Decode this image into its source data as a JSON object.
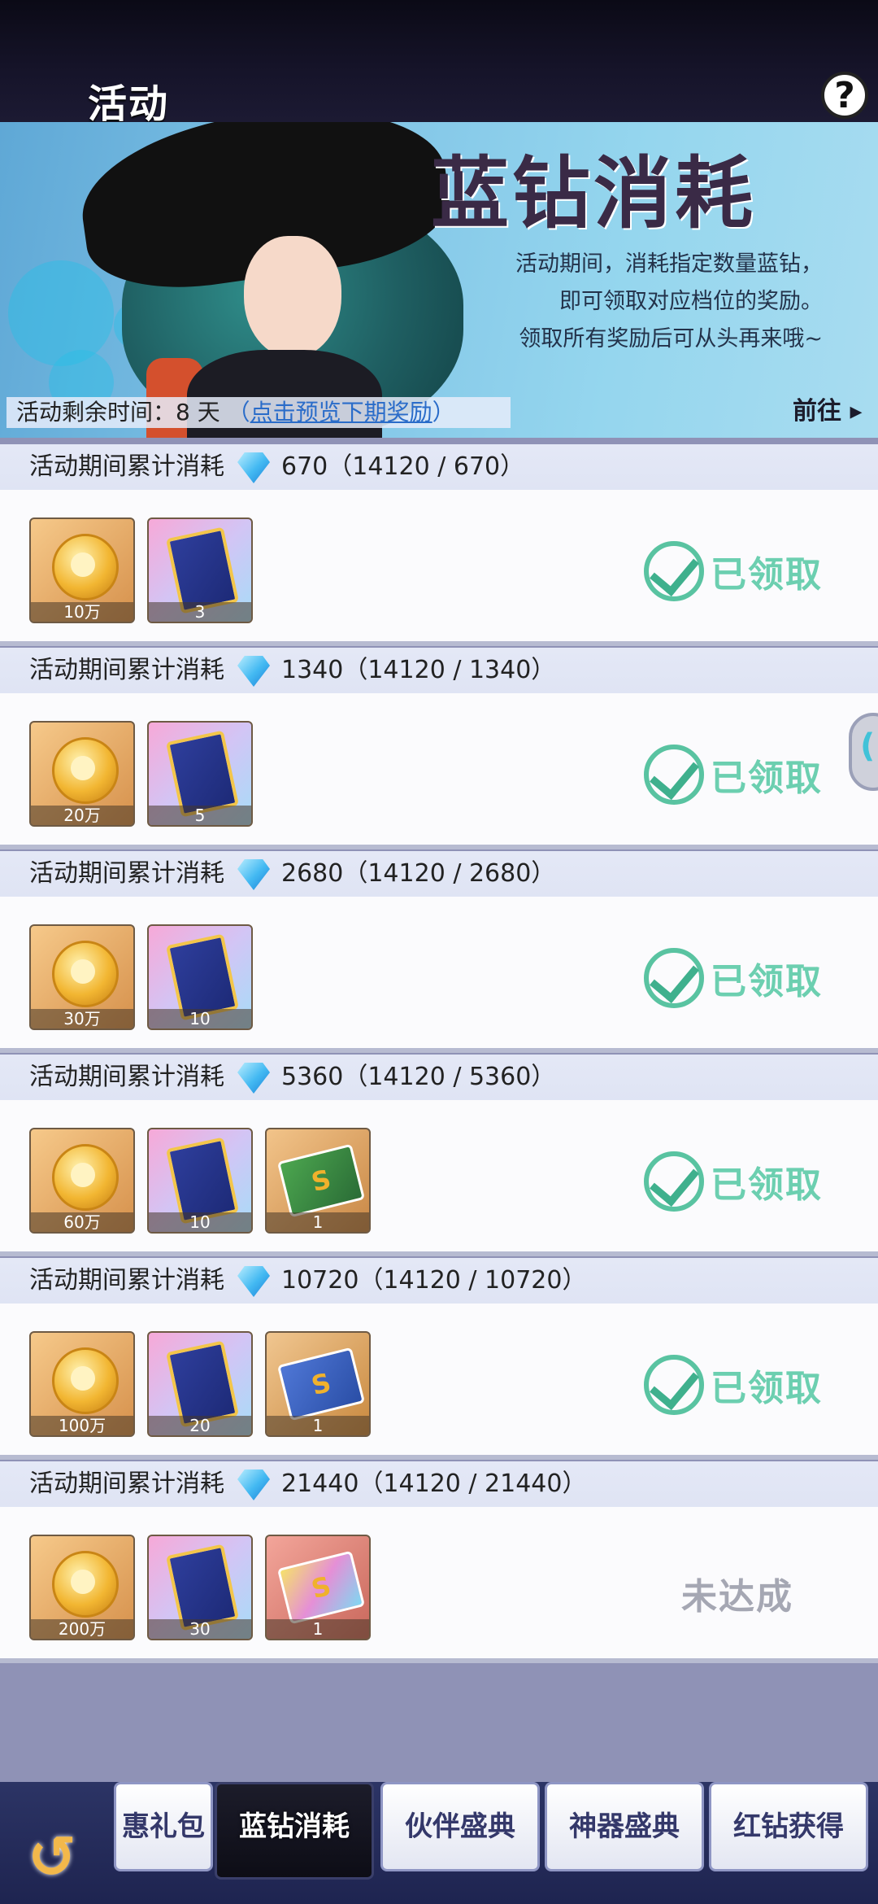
{
  "header": {
    "title": "活动",
    "help_icon": "?"
  },
  "banner": {
    "title": "蓝钻消耗",
    "desc_lines": [
      "活动期间，消耗指定数量蓝钻，",
      "即可领取对应档位的奖励。",
      "领取所有奖励后可从头再来哦~"
    ],
    "remain_label": "活动剩余时间：8 天",
    "preview_open": "（",
    "preview_link": "点击预览下期奖励",
    "preview_close": "）",
    "goto_label": "前往 ▸"
  },
  "tiers": [
    {
      "label": "活动期间累计消耗",
      "value": "670（14120 / 670）",
      "status": "已领取",
      "rewards": [
        {
          "type": "gold",
          "count": "10万"
        },
        {
          "type": "card",
          "count": "3"
        }
      ]
    },
    {
      "label": "活动期间累计消耗",
      "value": "1340（14120 / 1340）",
      "status": "已领取",
      "rewards": [
        {
          "type": "gold",
          "count": "20万"
        },
        {
          "type": "card",
          "count": "5"
        }
      ]
    },
    {
      "label": "活动期间累计消耗",
      "value": "2680（14120 / 2680）",
      "status": "已领取",
      "rewards": [
        {
          "type": "gold",
          "count": "30万"
        },
        {
          "type": "card",
          "count": "10"
        }
      ]
    },
    {
      "label": "活动期间累计消耗",
      "value": "5360（14120 / 5360）",
      "status": "已领取",
      "rewards": [
        {
          "type": "gold",
          "count": "60万"
        },
        {
          "type": "card",
          "count": "10"
        },
        {
          "type": "ticket-green",
          "count": "1"
        }
      ]
    },
    {
      "label": "活动期间累计消耗",
      "value": "10720（14120 / 10720）",
      "status": "已领取",
      "rewards": [
        {
          "type": "gold",
          "count": "100万"
        },
        {
          "type": "card",
          "count": "20"
        },
        {
          "type": "ticket-blue",
          "count": "1"
        }
      ]
    },
    {
      "label": "活动期间累计消耗",
      "value": "21440（14120 / 21440）",
      "status": "未达成",
      "rewards": [
        {
          "type": "gold",
          "count": "200万"
        },
        {
          "type": "card",
          "count": "30"
        },
        {
          "type": "ticket-rainbow",
          "count": "1"
        }
      ]
    }
  ],
  "ticket_symbol": "S",
  "nav": {
    "tabs": [
      {
        "label": "惠礼包",
        "active": false
      },
      {
        "label": "蓝钻消耗",
        "active": true
      },
      {
        "label": "伙伴盛典",
        "active": false
      },
      {
        "label": "神器盛典",
        "active": false
      },
      {
        "label": "红钻获得",
        "active": false
      }
    ]
  },
  "colors": {
    "claimed": "#59c3a1",
    "unreached": "#a5a7b3",
    "link": "#2a6cc9"
  }
}
